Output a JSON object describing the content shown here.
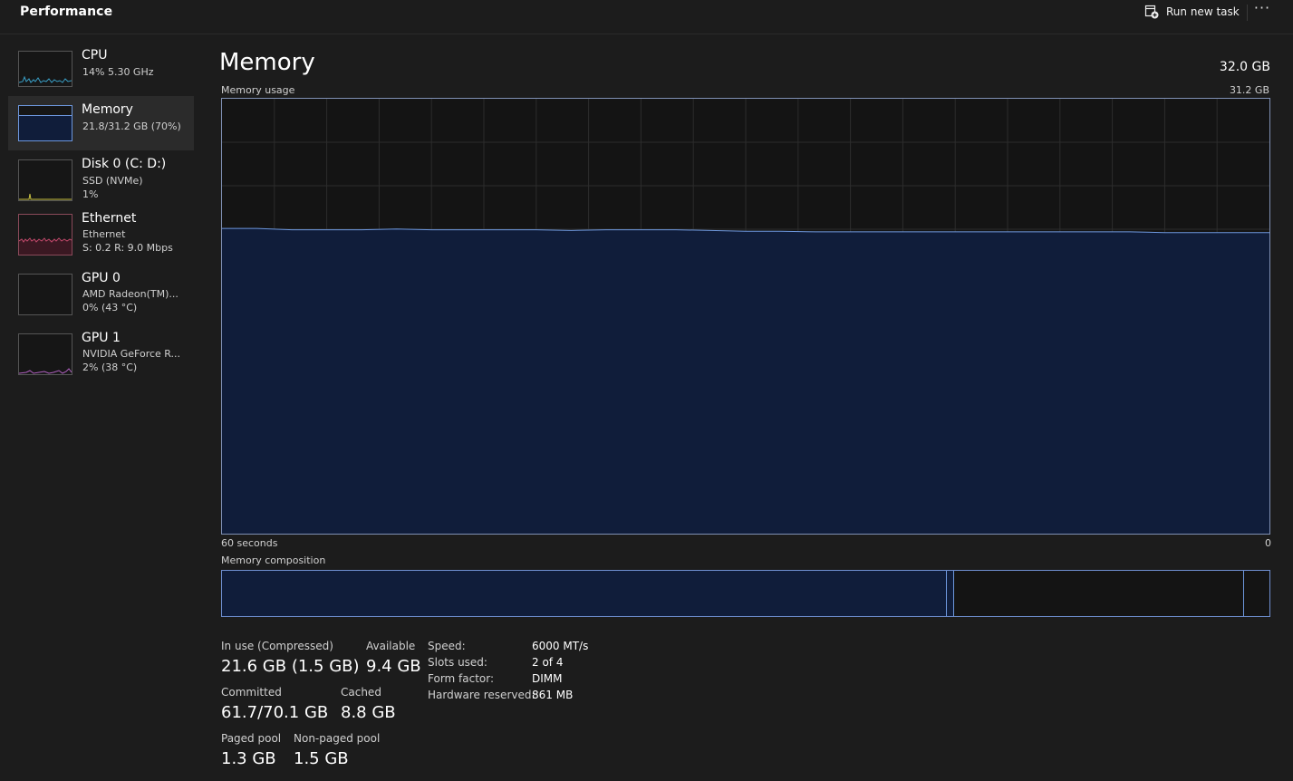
{
  "app": {
    "title": "Performance",
    "run_new_task": "Run new task",
    "more": "···"
  },
  "colors": {
    "memory_fill": "#101d3a",
    "memory_line": "#6d97dd",
    "cpu": "#3aa0c8",
    "ethernet": "#c0486a",
    "gpu": "#b060c0",
    "disk": "#c8c040"
  },
  "sidebar": {
    "items": [
      {
        "name": "CPU",
        "sub1": "14% 5.30 GHz",
        "sub2": ""
      },
      {
        "name": "Memory",
        "sub1": "21.8/31.2 GB (70%)",
        "sub2": ""
      },
      {
        "name": "Disk 0 (C: D:)",
        "sub1": "SSD (NVMe)",
        "sub2": "1%"
      },
      {
        "name": "Ethernet",
        "sub1": "Ethernet",
        "sub2": "S: 0.2 R: 9.0 Mbps"
      },
      {
        "name": "GPU 0",
        "sub1": "AMD Radeon(TM)...",
        "sub2": "0% (43 °C)"
      },
      {
        "name": "GPU 1",
        "sub1": "NVIDIA GeForce R...",
        "sub2": "2% (38 °C)"
      }
    ]
  },
  "main": {
    "title": "Memory",
    "total": "32.0 GB",
    "usage_label": "Memory usage",
    "usage_max": "31.2 GB",
    "x_left": "60 seconds",
    "x_right": "0",
    "composition_label": "Memory composition"
  },
  "chart_data": {
    "type": "area",
    "ylim": [
      0,
      31.2
    ],
    "xlim": [
      60,
      0
    ],
    "x": [
      60,
      58,
      56,
      54,
      52,
      50,
      48,
      46,
      44,
      42,
      40,
      38,
      36,
      34,
      32,
      30,
      28,
      26,
      24,
      22,
      20,
      18,
      16,
      14,
      12,
      10,
      8,
      6,
      4,
      2,
      0
    ],
    "values": [
      21.9,
      21.9,
      21.8,
      21.8,
      21.8,
      21.85,
      21.8,
      21.8,
      21.8,
      21.8,
      21.75,
      21.8,
      21.8,
      21.8,
      21.75,
      21.7,
      21.7,
      21.65,
      21.65,
      21.65,
      21.65,
      21.65,
      21.65,
      21.65,
      21.65,
      21.65,
      21.65,
      21.6,
      21.6,
      21.6,
      21.6
    ],
    "composition": {
      "in_use": 21.6,
      "modified": 0.2,
      "standby": 8.8,
      "free": 0.6
    }
  },
  "stats": {
    "in_use_label": "In use (Compressed)",
    "in_use_value": "21.6 GB (1.5 GB)",
    "available_label": "Available",
    "available_value": "9.4 GB",
    "committed_label": "Committed",
    "committed_value": "61.7/70.1 GB",
    "cached_label": "Cached",
    "cached_value": "8.8 GB",
    "paged_label": "Paged pool",
    "paged_value": "1.3 GB",
    "nonpaged_label": "Non-paged pool",
    "nonpaged_value": "1.5 GB"
  },
  "hardware": {
    "speed_label": "Speed:",
    "speed_value": "6000 MT/s",
    "slots_label": "Slots used:",
    "slots_value": "2 of 4",
    "form_label": "Form factor:",
    "form_value": "DIMM",
    "reserved_label": "Hardware reserved:",
    "reserved_value": "861 MB"
  }
}
